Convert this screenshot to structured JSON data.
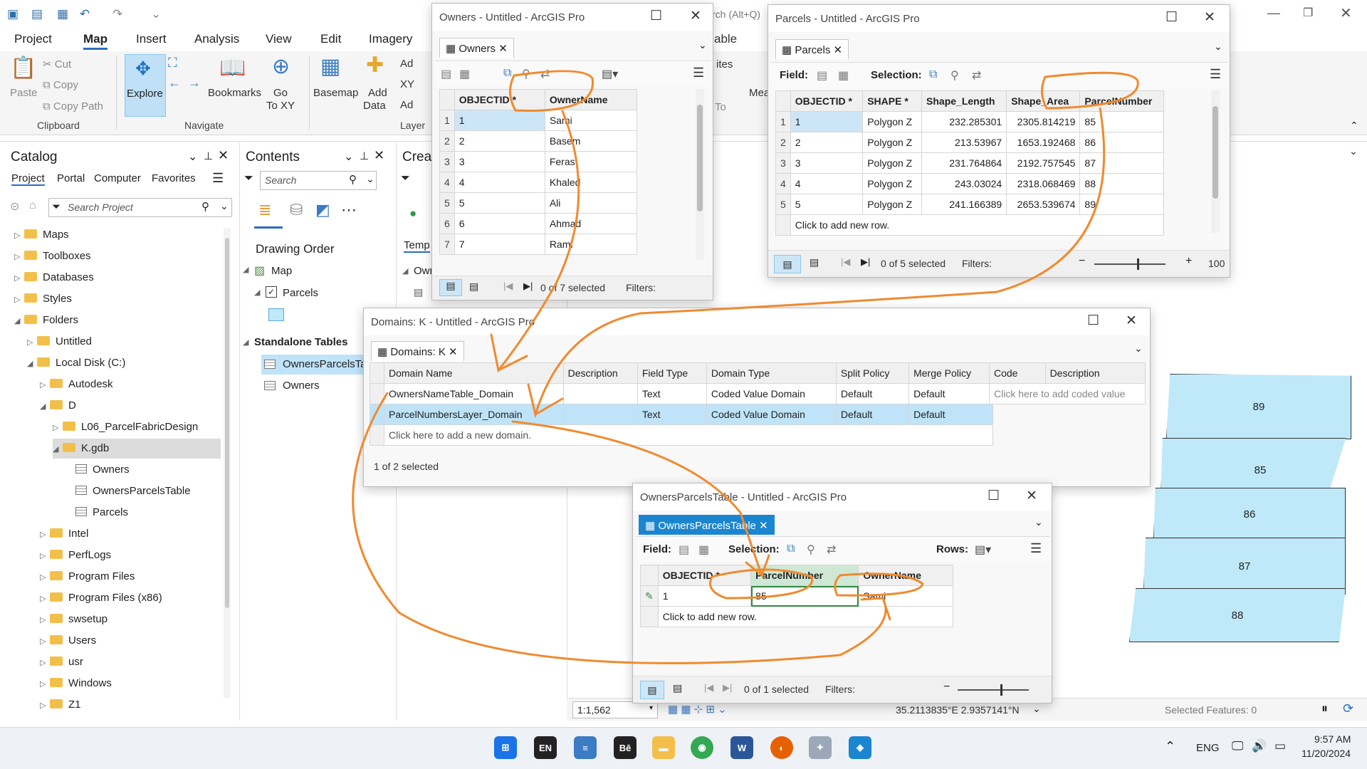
{
  "qat": {
    "search_hint": "rch (Alt+Q)"
  },
  "ribbon_tabs": [
    "Project",
    "Map",
    "Insert",
    "Analysis",
    "View",
    "Edit",
    "Imagery"
  ],
  "ribbon": {
    "clipboard": {
      "paste": "Paste",
      "cut": "Cut",
      "copy": "Copy",
      "copy_path": "Copy Path",
      "group": "Clipboard"
    },
    "navigate": {
      "explore": "Explore",
      "bookmarks": "Bookmarks",
      "goto": "Go\nTo XY",
      "go": "Go",
      "toxy": "To XY",
      "group": "Navigate"
    },
    "layer": {
      "basemap": "Basemap",
      "add_data": "Add",
      "add_data2": "Data",
      "ad1": "Ad",
      "xy": "XY",
      "ad2": "Ad",
      "group": "Layer"
    },
    "partial": {
      "table": "able",
      "ites": "ites",
      "to": "To",
      "mea": "Mea"
    }
  },
  "catalog": {
    "title": "Catalog",
    "tabs": [
      "Project",
      "Portal",
      "Computer",
      "Favorites"
    ],
    "search_placeholder": "Search Project",
    "items": [
      {
        "label": "Maps",
        "indent": 0,
        "caret": "▷"
      },
      {
        "label": "Toolboxes",
        "indent": 0,
        "caret": "▷"
      },
      {
        "label": "Databases",
        "indent": 0,
        "caret": "▷"
      },
      {
        "label": "Styles",
        "indent": 0,
        "caret": "▷"
      },
      {
        "label": "Folders",
        "indent": 0,
        "caret": "◢"
      },
      {
        "label": "Untitled",
        "indent": 1,
        "caret": "▷"
      },
      {
        "label": "Local Disk (C:)",
        "indent": 1,
        "caret": "◢"
      },
      {
        "label": "Autodesk",
        "indent": 2,
        "caret": "▷"
      },
      {
        "label": "D",
        "indent": 2,
        "caret": "◢"
      },
      {
        "label": "L06_ParcelFabricDesign",
        "indent": 3,
        "caret": "▷"
      },
      {
        "label": "K.gdb",
        "indent": 3,
        "caret": "◢"
      },
      {
        "label": "Owners",
        "indent": 4,
        "caret": ""
      },
      {
        "label": "OwnersParcelsTable",
        "indent": 4,
        "caret": ""
      },
      {
        "label": "Parcels",
        "indent": 4,
        "caret": ""
      },
      {
        "label": "Intel",
        "indent": 2,
        "caret": "▷"
      },
      {
        "label": "PerfLogs",
        "indent": 2,
        "caret": "▷"
      },
      {
        "label": "Program Files",
        "indent": 2,
        "caret": "▷"
      },
      {
        "label": "Program Files (x86)",
        "indent": 2,
        "caret": "▷"
      },
      {
        "label": "swsetup",
        "indent": 2,
        "caret": "▷"
      },
      {
        "label": "Users",
        "indent": 2,
        "caret": "▷"
      },
      {
        "label": "usr",
        "indent": 2,
        "caret": "▷"
      },
      {
        "label": "Windows",
        "indent": 2,
        "caret": "▷"
      },
      {
        "label": "Z1",
        "indent": 2,
        "caret": "▷"
      }
    ]
  },
  "contents": {
    "title": "Contents",
    "search_placeholder": "Search",
    "drawing_order": "Drawing Order",
    "map": "Map",
    "parcels": "Parcels",
    "standalone": "Standalone Tables",
    "t1": "OwnersParcelsTal",
    "t2": "Owners"
  },
  "create": {
    "title": "Creat",
    "temp": "Temp",
    "own": "Own"
  },
  "owners_win": {
    "title": "Owners - Untitled - ArcGIS Pro",
    "tab": "Owners",
    "cols": [
      "OBJECTID *",
      "OwnerName"
    ],
    "rows": [
      [
        "1",
        "1",
        "Sami"
      ],
      [
        "2",
        "2",
        "Basem"
      ],
      [
        "3",
        "3",
        "Feras"
      ],
      [
        "4",
        "4",
        "Khaled"
      ],
      [
        "5",
        "5",
        "Ali"
      ],
      [
        "6",
        "6",
        "Ahmad"
      ],
      [
        "7",
        "7",
        "Rami"
      ]
    ],
    "status": "0 of 7 selected",
    "filters": "Filters:"
  },
  "parcels_win": {
    "title": "Parcels - Untitled - ArcGIS Pro",
    "tab": "Parcels",
    "field": "Field:",
    "selection": "Selection:",
    "cols": [
      "OBJECTID *",
      "SHAPE *",
      "Shape_Length",
      "Shape_Area",
      "ParcelNumber"
    ],
    "rows": [
      [
        "1",
        "1",
        "Polygon Z",
        "232.285301",
        "2305.814219",
        "85"
      ],
      [
        "2",
        "2",
        "Polygon Z",
        "213.53967",
        "1653.192468",
        "86"
      ],
      [
        "3",
        "3",
        "Polygon Z",
        "231.764864",
        "2192.757545",
        "87"
      ],
      [
        "4",
        "4",
        "Polygon Z",
        "243.03024",
        "2318.068469",
        "88"
      ],
      [
        "5",
        "5",
        "Polygon Z",
        "241.166389",
        "2653.539674",
        "89"
      ]
    ],
    "new_row": "Click to add new row.",
    "status": "0 of 5 selected",
    "filters": "Filters:",
    "zoom": "100"
  },
  "domains_win": {
    "title": "Domains: K - Untitled - ArcGIS Pro",
    "tab": "Domains: K",
    "cols": [
      "Domain Name",
      "Description",
      "Field Type",
      "Domain Type",
      "Split Policy",
      "Merge Policy"
    ],
    "rows": [
      [
        "OwnersNameTable_Domain",
        "",
        "Text",
        "Coded Value Domain",
        "Default",
        "Default"
      ],
      [
        "ParcelNumbersLayer_Domain",
        "",
        "Text",
        "Coded Value Domain",
        "Default",
        "Default"
      ]
    ],
    "new_row": "Click here to add a new domain.",
    "status": "1 of 2 selected",
    "code_cols": [
      "Code",
      "Description"
    ],
    "code_new": "Click here to add coded value"
  },
  "opt_win": {
    "title": "OwnersParcelsTable - Untitled - ArcGIS Pro",
    "tab": "OwnersParcelsTable",
    "field": "Field:",
    "selection": "Selection:",
    "rows_lbl": "Rows:",
    "cols": [
      "OBJECTID *",
      "ParcelNumber",
      "OwnerName"
    ],
    "rows": [
      [
        "1",
        "85",
        "Sami"
      ]
    ],
    "new_row": "Click to add new row.",
    "status": "0 of 1 selected",
    "filters": "Filters:"
  },
  "map": {
    "parcels": [
      "89",
      "85",
      "86",
      "87",
      "88"
    ],
    "scale": "1:1,562",
    "coords": "35.2113835°E 2.9357141°N",
    "selected_features": "Selected Features: 0"
  },
  "taskbar": {
    "lang": "ENG",
    "time": "9:57 AM",
    "date": "11/20/2024",
    "en": "EN"
  },
  "colors": {
    "accent": "#2a6fbd",
    "selection": "#bfe3f9",
    "annotation": "#f08a2e",
    "parcel_fill": "#bfe9f9"
  }
}
